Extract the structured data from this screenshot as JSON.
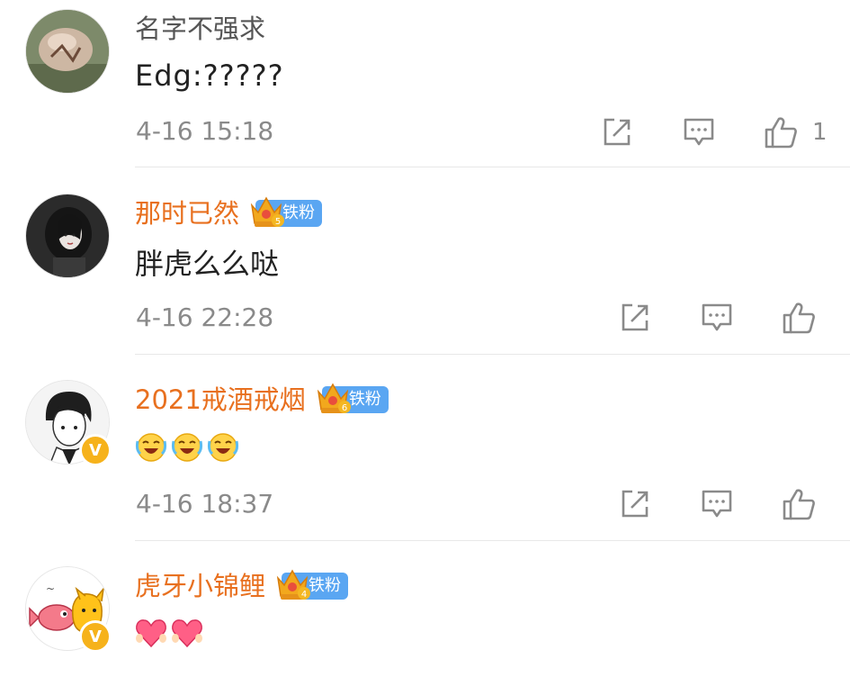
{
  "comments": [
    {
      "username": "名字不强求",
      "badge": "",
      "text": "Edg:?????",
      "emojis": [],
      "time": "4-16 15:18",
      "likes": "1",
      "verified": false
    },
    {
      "username": "那时已然",
      "badge": "铁粉",
      "badge_level": "5",
      "text": "胖虎么么哒",
      "emojis": [],
      "time": "4-16 22:28",
      "likes": "",
      "verified": false
    },
    {
      "username": "2021戒酒戒烟",
      "badge": "铁粉",
      "badge_level": "6",
      "text": "",
      "emojis": [
        "laugh-cry-emoji",
        "laugh-cry-emoji",
        "laugh-cry-emoji"
      ],
      "time": "4-16 18:37",
      "likes": "",
      "verified": true
    },
    {
      "username": "虎牙小锦鲤",
      "badge": "铁粉",
      "badge_level": "4",
      "text": "",
      "emojis": [
        "heart-hands-emoji",
        "heart-hands-emoji"
      ],
      "time": "",
      "likes": "",
      "verified": true
    }
  ],
  "icons": {
    "repost": "repost-icon",
    "comment": "comment-icon",
    "like": "like-icon"
  },
  "colors": {
    "username_vip": "#e8701f",
    "badge_bg": "#5aa6f2",
    "verified": "#f6b21b"
  }
}
